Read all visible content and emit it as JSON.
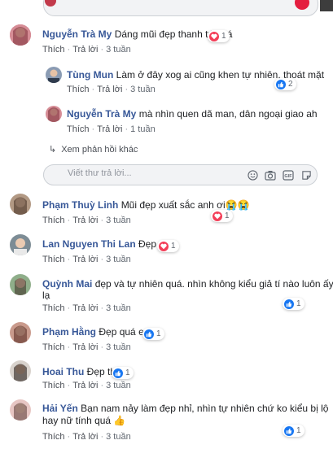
{
  "reply_placeholder": "Viết thư trả lời...",
  "more_replies_label": "Xem phản hồi khác",
  "action_like": "Thích",
  "action_reply": "Trả lời",
  "comments": [
    {
      "name": "Nguyễn Trà My",
      "text": "Dáng mũi đẹp thanh tú quá",
      "time": "3 tuần",
      "reaction": "heart",
      "reaction_count": "1"
    },
    {
      "name": "Tùng Mun",
      "text": "Làm ở đây xog ai cũng khen tự nhiên, thoát mặt",
      "time": "3 tuần",
      "reaction": "like",
      "reaction_count": "2"
    },
    {
      "name": "Nguyễn Trà My",
      "text": "mà nhìn quen dã man, dân ngoại giao ah",
      "time": "1 tuần",
      "reaction": "",
      "reaction_count": ""
    },
    {
      "name": "Phạm Thuỳ Linh",
      "text": "Mũi đẹp xuất sắc anh ơi😭😭",
      "time": "3 tuần",
      "reaction": "heart",
      "reaction_count": "1"
    },
    {
      "name": "Lan Nguyen Thi Lan",
      "text": "Đẹp quá",
      "time": "3 tuần",
      "reaction": "heart",
      "reaction_count": "1"
    },
    {
      "name": "Quỳnh Mai",
      "text": "đẹp và tự nhiên quá. nhìn không kiểu giả tí nào luôn ấy",
      "text2": "lạ",
      "time": "3 tuần",
      "reaction": "like",
      "reaction_count": "1"
    },
    {
      "name": "Phạm Hằng",
      "text": "Đẹp quá e ah",
      "time": "3 tuần",
      "reaction": "like",
      "reaction_count": "1"
    },
    {
      "name": "Hoai Thu",
      "text": "Đẹp thế",
      "time": "3 tuần",
      "reaction": "like",
      "reaction_count": "1"
    },
    {
      "name": "Hải Yến",
      "text": "Bạn nam nảy làm đẹp nhỉ, nhìn tự nhiên chứ ko kiểu bị lộ",
      "text2": "hay nữ tính quá 👍",
      "time": "3 tuần",
      "reaction": "like",
      "reaction_count": "1"
    }
  ],
  "colors": {
    "name": "#385898",
    "heart": "#f33e58",
    "like": "#1877f2",
    "meta": "#606770"
  }
}
